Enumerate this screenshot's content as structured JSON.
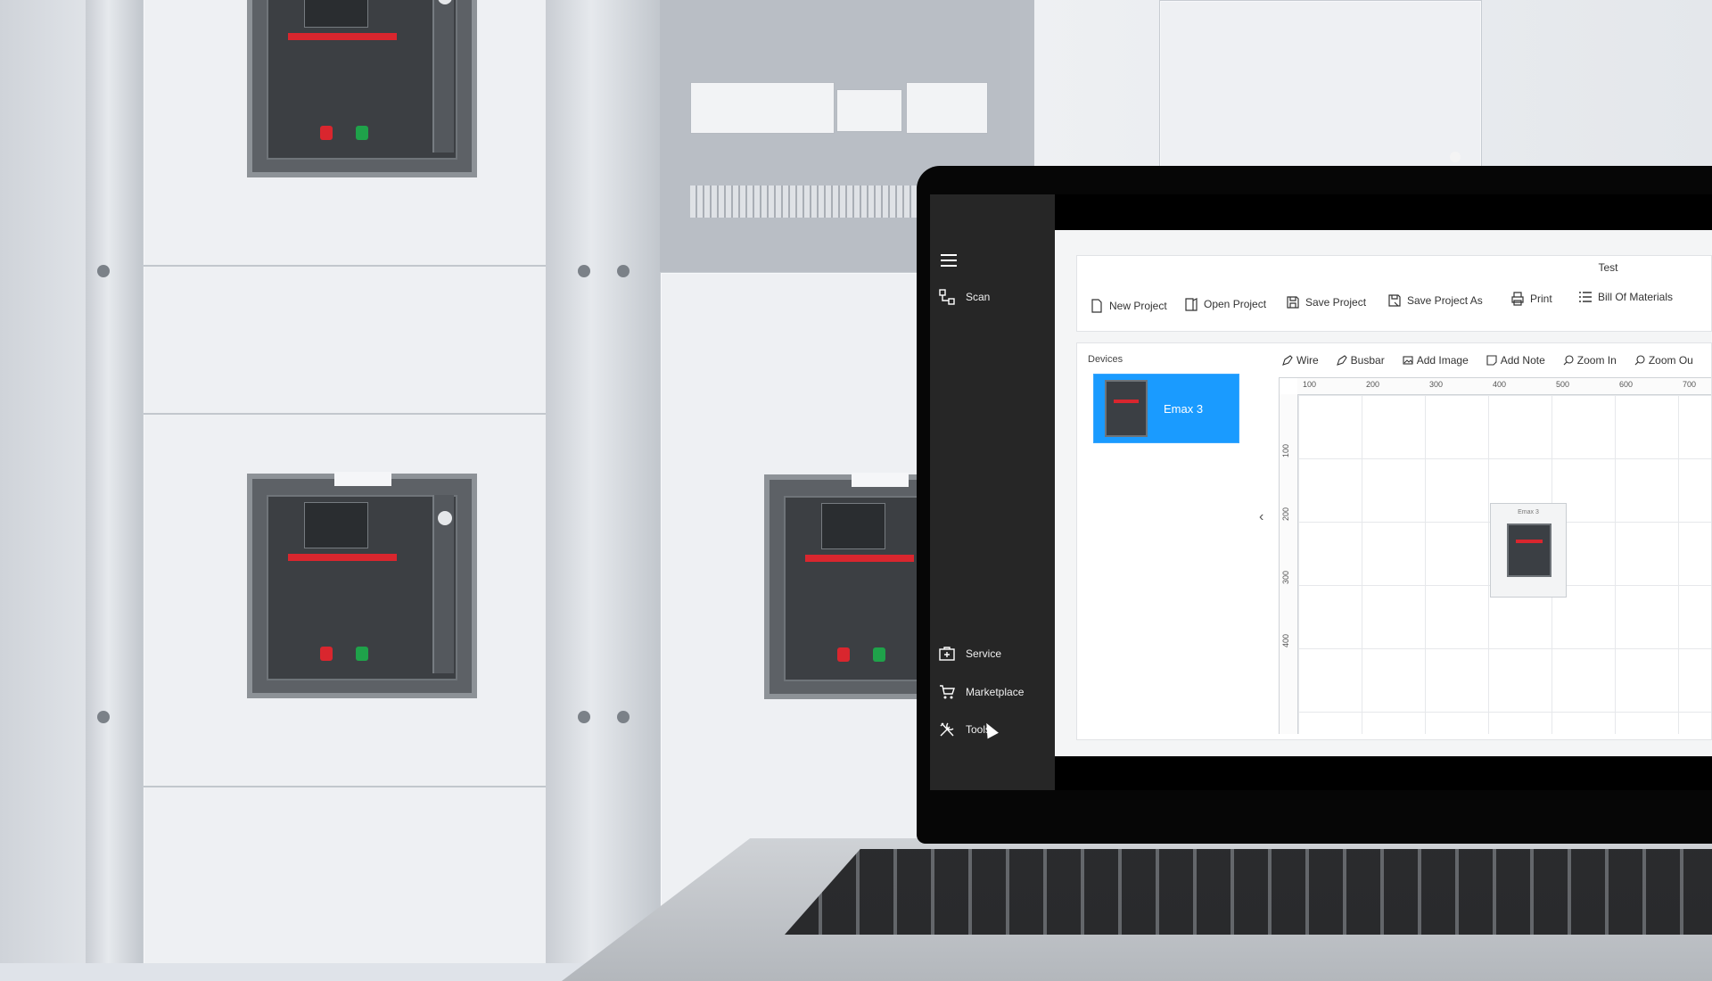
{
  "app": {
    "document_title": "Test"
  },
  "sidebar": {
    "items": [
      {
        "label": "Scan",
        "icon": "scan-icon"
      },
      {
        "label": "Service",
        "icon": "service-icon"
      },
      {
        "label": "Marketplace",
        "icon": "cart-icon"
      },
      {
        "label": "Tools",
        "icon": "tools-icon"
      }
    ]
  },
  "toolbar": {
    "new_project": "New Project",
    "open_project": "Open Project",
    "save_project": "Save Project",
    "save_project_as": "Save Project As",
    "print": "Print",
    "bill_of_materials": "Bill Of Materials"
  },
  "devices": {
    "label": "Devices",
    "items": [
      {
        "name": "Emax 3"
      }
    ]
  },
  "edit_tools": {
    "wire": "Wire",
    "busbar": "Busbar",
    "add_image": "Add Image",
    "add_note": "Add Note",
    "zoom_in": "Zoom In",
    "zoom_out": "Zoom Ou"
  },
  "canvas": {
    "ruler_x": [
      "100",
      "200",
      "300",
      "400",
      "500",
      "600",
      "700"
    ],
    "ruler_y": [
      "100",
      "200",
      "300",
      "400"
    ],
    "placed_device_label": "Emax 3"
  },
  "colors": {
    "accent": "#1a9bff",
    "sidebar_bg": "#262626",
    "brand_red": "#d9262e"
  }
}
